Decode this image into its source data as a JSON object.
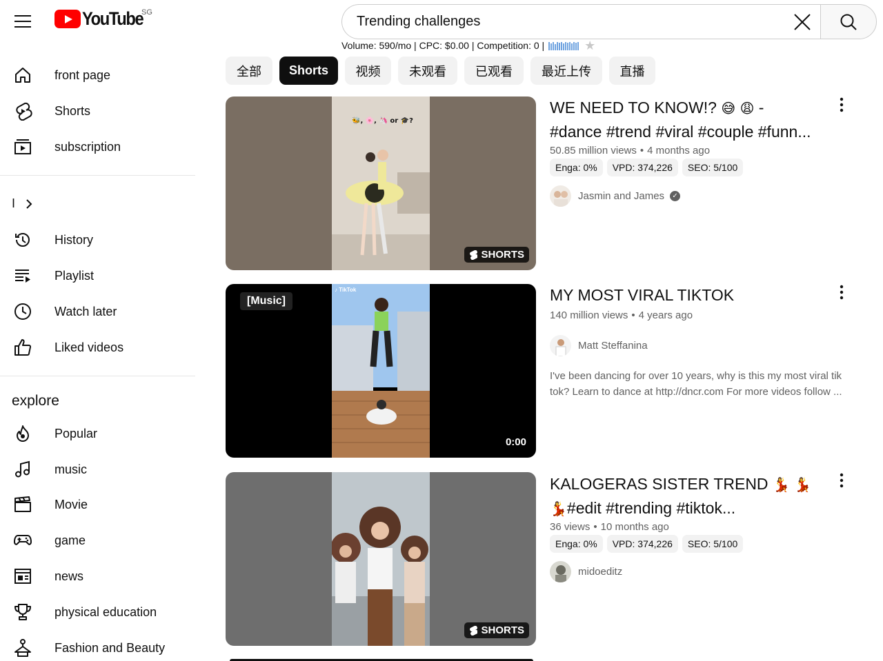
{
  "header": {
    "logo_text": "YouTube",
    "country_code": "SG",
    "search_value": "Trending challenges",
    "menu_icon": "hamburger-icon",
    "clear_icon": "close-icon",
    "search_icon": "search-icon"
  },
  "seo": {
    "text": "Volume: 590/mo | CPC: $0.00 | Competition: 0 |"
  },
  "sidebar": {
    "primary": [
      {
        "label": "front page",
        "icon": "home-icon"
      },
      {
        "label": "Shorts",
        "icon": "shorts-icon"
      },
      {
        "label": "subscription",
        "icon": "subscriptions-icon"
      }
    ],
    "you_label": "I",
    "library": [
      {
        "label": "History",
        "icon": "history-icon"
      },
      {
        "label": "Playlist",
        "icon": "playlist-icon"
      },
      {
        "label": "Watch later",
        "icon": "clock-icon"
      },
      {
        "label": "Liked videos",
        "icon": "thumbs-up-icon"
      }
    ],
    "explore_title": "explore",
    "explore": [
      {
        "label": "Popular",
        "icon": "flame-icon"
      },
      {
        "label": "music",
        "icon": "music-note-icon"
      },
      {
        "label": "Movie",
        "icon": "clapperboard-icon"
      },
      {
        "label": "game",
        "icon": "gamepad-icon"
      },
      {
        "label": "news",
        "icon": "newspaper-icon"
      },
      {
        "label": "physical education",
        "icon": "trophy-icon"
      },
      {
        "label": "Fashion and Beauty",
        "icon": "hanger-icon"
      }
    ]
  },
  "chips": [
    {
      "label": "全部",
      "active": false
    },
    {
      "label": "Shorts",
      "active": true
    },
    {
      "label": "视频",
      "active": false
    },
    {
      "label": "未观看",
      "active": false
    },
    {
      "label": "已观看",
      "active": false
    },
    {
      "label": "最近上传",
      "active": false
    },
    {
      "label": "直播",
      "active": false
    }
  ],
  "results": [
    {
      "title_line1": "WE NEED TO KNOW!? ",
      "title_emoji": "😅 😩",
      "title_line1_tail": " -",
      "title_line2": "#dance #trend #viral #couple #funn...",
      "views": "50.85 million views",
      "age": "4 months ago",
      "pills": [
        "Enga: 0%",
        "VPD: 374,226",
        "SEO: 5/100"
      ],
      "channel": "Jasmin and James",
      "verified": true,
      "badge": "SHORTS",
      "thumb_overlay_text": "🐝, 🌸, 🦄 or 🎓?",
      "bg_color": "#7a6e62",
      "accent": "#e6e08a"
    },
    {
      "title_line1": "MY MOST VIRAL TIKTOK",
      "views": "140 million views",
      "age": "4 years ago",
      "channel": "Matt Steffanina",
      "description": "I've been dancing for over 10 years, why is this my most viral tik tok? Learn to dance at http://dncr.com For more videos follow ...",
      "badge_music": "[Music]",
      "duration": "0:00",
      "tiktok_label": "TikTok",
      "bg_color": "#000000"
    },
    {
      "title_line1": "KALOGERAS SISTER TREND ",
      "title_emoji": "💃 💃",
      "title_line2_emoji": "💃",
      "title_line2": "#edit #trending #tiktok...",
      "views": "36 views",
      "age": "10 months ago",
      "pills": [
        "Enga: 0%",
        "VPD: 374,226",
        "SEO: 5/100"
      ],
      "channel": "midoeditz",
      "badge": "SHORTS",
      "bg_color": "#6e6e6e"
    }
  ],
  "colors": {
    "brand": "#ff0000",
    "text_primary": "#0f0f0f",
    "text_secondary": "#606060",
    "chip_bg": "#f2f2f2",
    "chip_active_bg": "#0f0f0f",
    "seo_bars": "#6fa3e0"
  }
}
